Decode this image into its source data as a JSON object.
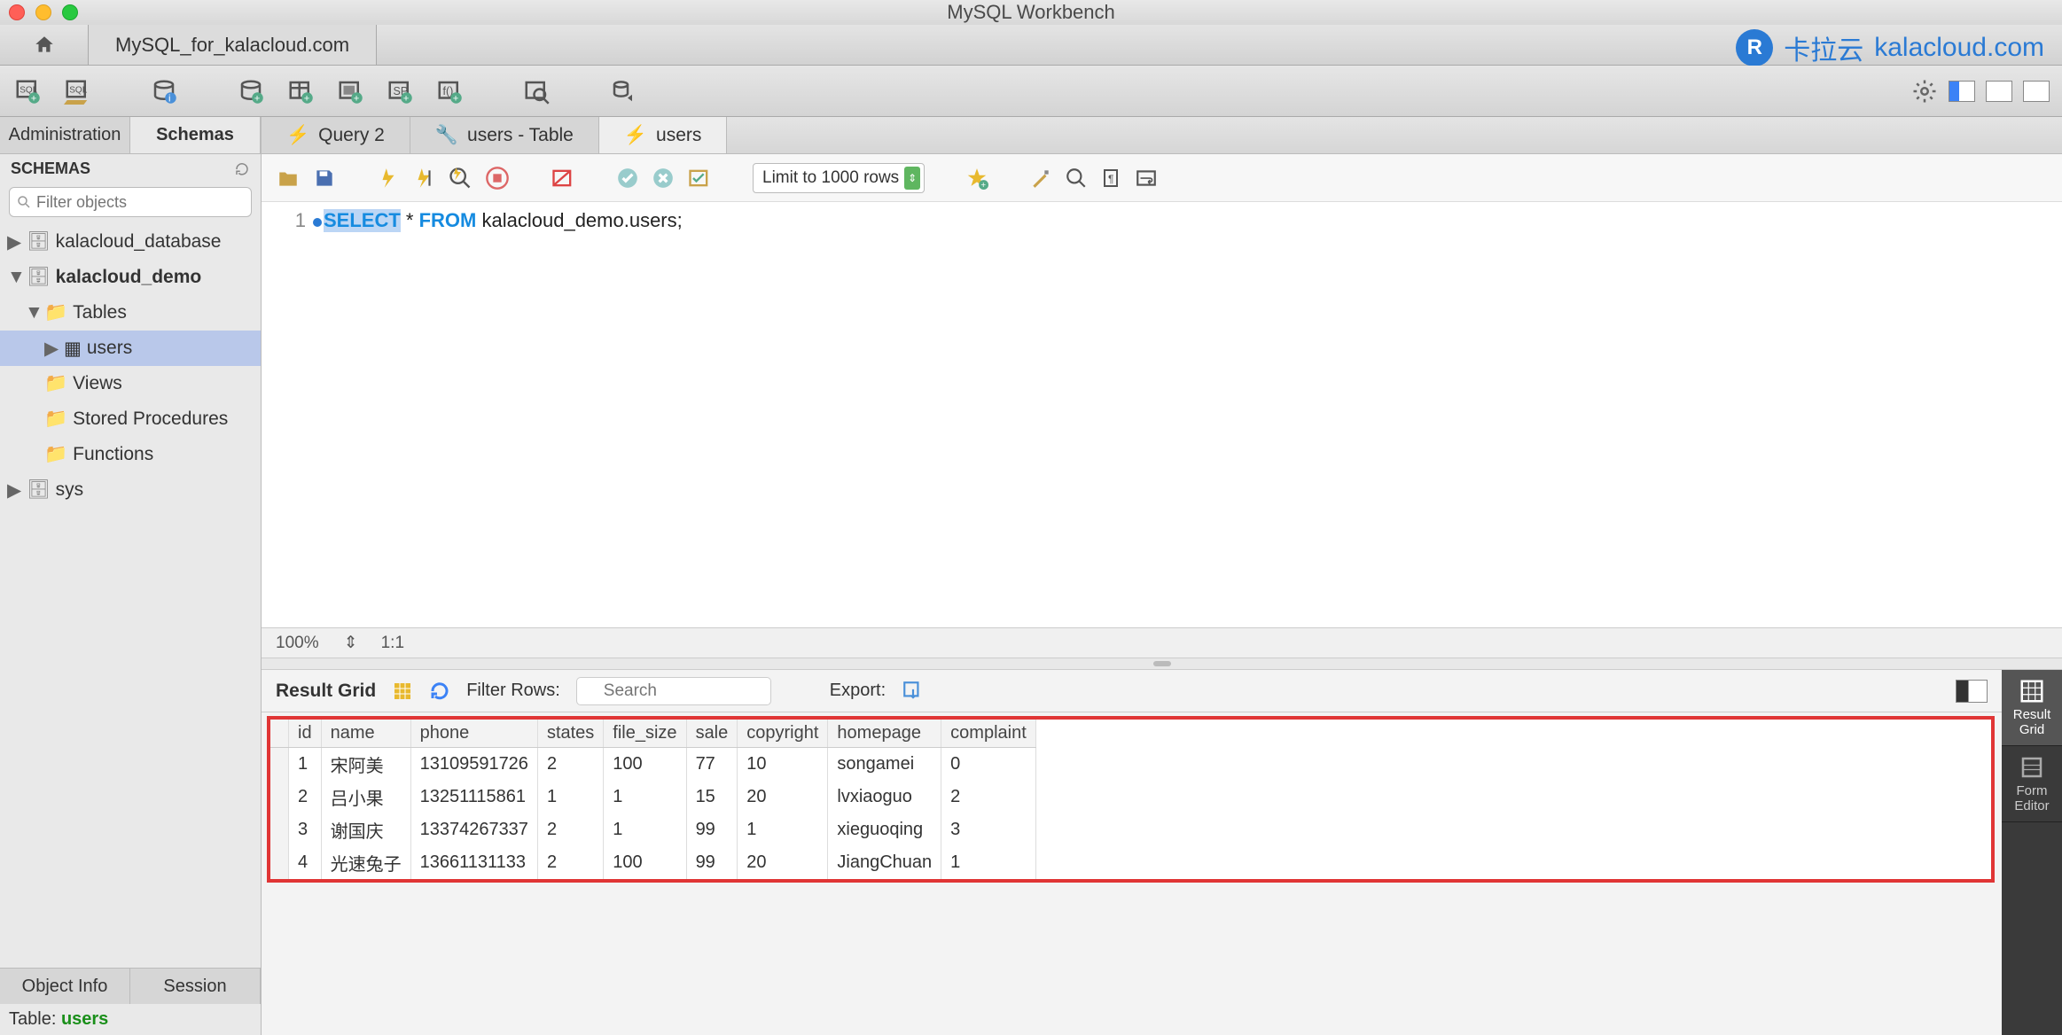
{
  "window": {
    "title": "MySQL Workbench"
  },
  "connection_tab": "MySQL_for_kalacloud.com",
  "watermark": {
    "brand_cn": "卡拉云",
    "brand_en": "kalacloud.com"
  },
  "sidebar": {
    "tabs": {
      "admin": "Administration",
      "schemas": "Schemas"
    },
    "header": "SCHEMAS",
    "filter_placeholder": "Filter objects",
    "tree": {
      "db1": "kalacloud_database",
      "db2": "kalacloud_demo",
      "tables_label": "Tables",
      "users_label": "users",
      "views_label": "Views",
      "sp_label": "Stored Procedures",
      "fn_label": "Functions",
      "sys_label": "sys"
    },
    "bottom_tabs": {
      "object_info": "Object Info",
      "session": "Session"
    },
    "info_label": "Table:",
    "info_value": "users"
  },
  "editor": {
    "tabs": {
      "q2": "Query 2",
      "users_table": "users - Table",
      "users": "users"
    },
    "limit_label": "Limit to 1000 rows",
    "line_no": "1",
    "sql_select": "SELECT",
    "sql_star": "*",
    "sql_from": "FROM",
    "sql_rest": "kalacloud_demo.users;",
    "zoom": "100%",
    "pos": "1:1"
  },
  "result": {
    "title": "Result Grid",
    "filter_label": "Filter Rows:",
    "search_placeholder": "Search",
    "export_label": "Export:",
    "side": {
      "grid": "Result\nGrid",
      "form": "Form\nEditor"
    },
    "columns": [
      "id",
      "name",
      "phone",
      "states",
      "file_size",
      "sale",
      "copyright",
      "homepage",
      "complaint"
    ],
    "rows": [
      {
        "id": "1",
        "name": "宋阿美",
        "phone": "13109591726",
        "states": "2",
        "file_size": "100",
        "sale": "77",
        "copyright": "10",
        "homepage": "songamei",
        "complaint": "0"
      },
      {
        "id": "2",
        "name": "吕小果",
        "phone": "13251115861",
        "states": "1",
        "file_size": "1",
        "sale": "15",
        "copyright": "20",
        "homepage": "lvxiaoguo",
        "complaint": "2"
      },
      {
        "id": "3",
        "name": "谢国庆",
        "phone": "13374267337",
        "states": "2",
        "file_size": "1",
        "sale": "99",
        "copyright": "1",
        "homepage": "xieguoqing",
        "complaint": "3"
      },
      {
        "id": "4",
        "name": "光速兔子",
        "phone": "13661131133",
        "states": "2",
        "file_size": "100",
        "sale": "99",
        "copyright": "20",
        "homepage": "JiangChuan",
        "complaint": "1"
      }
    ]
  }
}
